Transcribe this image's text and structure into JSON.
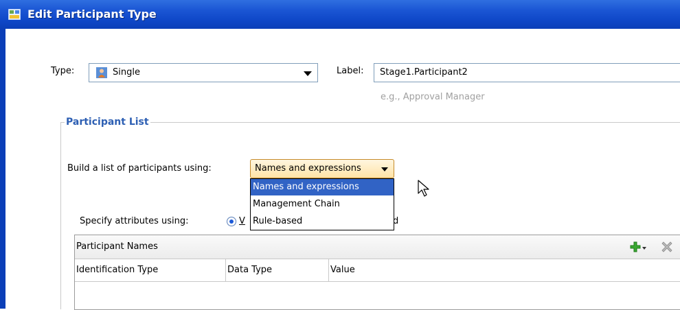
{
  "window": {
    "title": "Edit Participant Type",
    "icon": "app-dialog-icon"
  },
  "type_field": {
    "label": "Type:",
    "value": "Single",
    "icon": "person-icon"
  },
  "label_field": {
    "label": "Label:",
    "value": "Stage1.Participant2",
    "hint": "e.g., Approval Manager"
  },
  "participant_list": {
    "group_title": "Participant List",
    "build_label": "Build a list of participants using:",
    "build_value": "Names and expressions",
    "options": [
      "Names and expressions",
      "Management Chain",
      "Rule-based"
    ],
    "selected_index": 0,
    "specify_label": "Specify attributes using:",
    "radio_visible_fragment_left": "V",
    "radio_visible_fragment_right": "d"
  },
  "participant_names": {
    "title": "Participant Names",
    "add_icon": "add-icon",
    "delete_icon": "delete-icon",
    "columns": [
      "Identification Type",
      "Data Type",
      "Value"
    ]
  }
}
